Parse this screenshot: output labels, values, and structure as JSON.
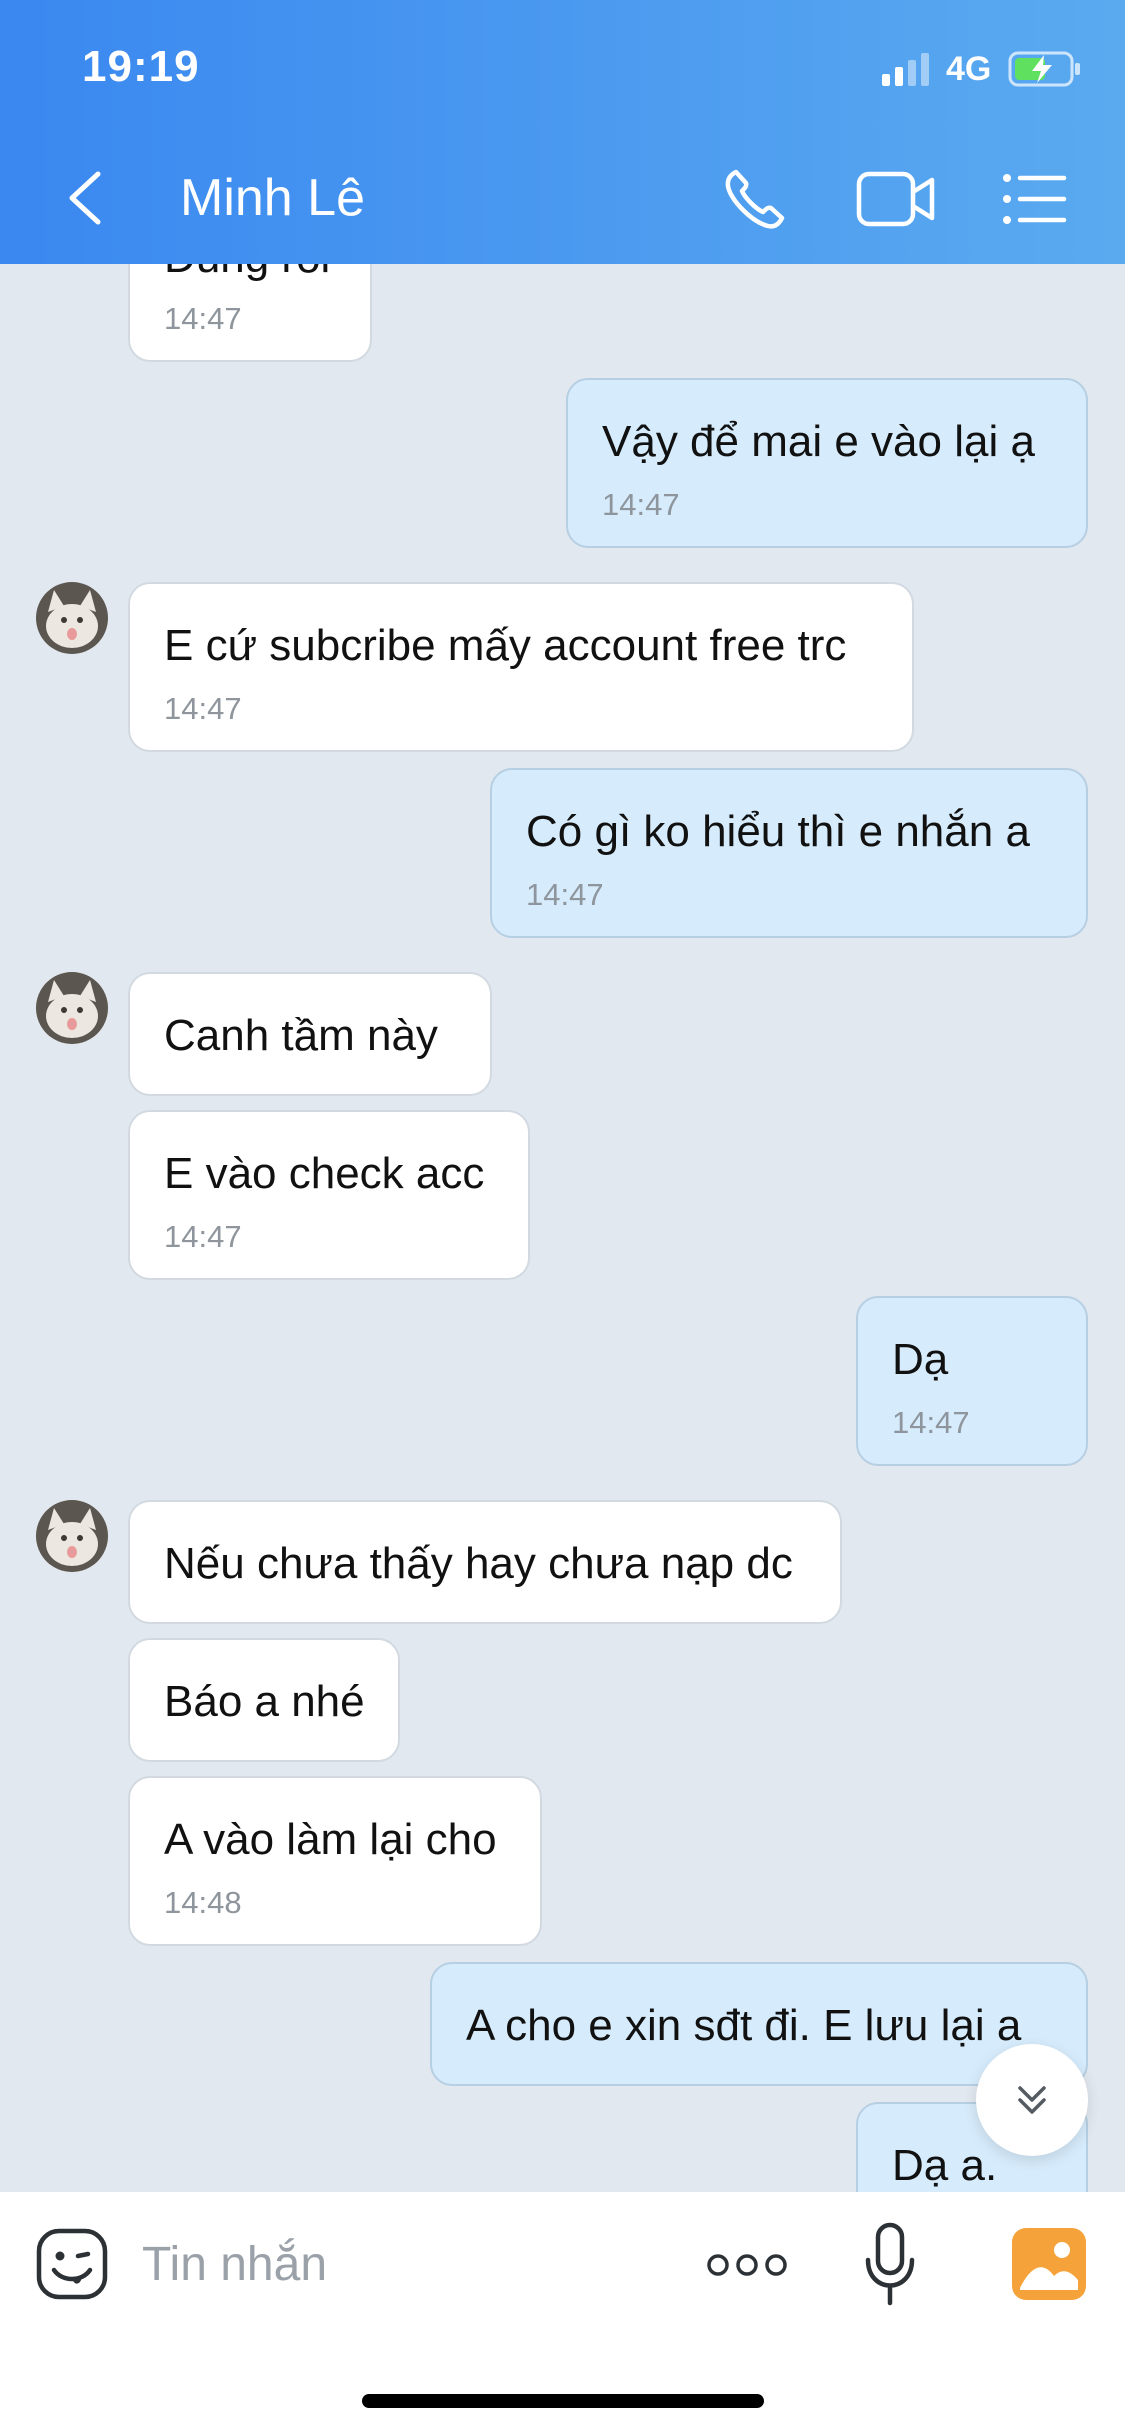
{
  "status_bar": {
    "time": "19:19",
    "network": "4G"
  },
  "header": {
    "contact_name": "Minh Lê",
    "back_icon": "chevron-left-icon",
    "call_icon": "phone-icon",
    "video_icon": "video-camera-icon",
    "menu_icon": "list-menu-icon"
  },
  "messages": [
    {
      "text": "Đúng rồi",
      "time": "14:47",
      "direction": "in"
    },
    {
      "text": "Vậy để mai e vào lại ạ",
      "time": "14:47",
      "direction": "out"
    },
    {
      "text": "E cứ subcribe mấy account free trc",
      "time": "14:47",
      "direction": "in"
    },
    {
      "text": "Có gì ko hiểu thì e nhắn a",
      "time": "14:47",
      "direction": "out"
    },
    {
      "text": "Canh tầm này",
      "time": "",
      "direction": "in"
    },
    {
      "text": "E vào check acc",
      "time": "14:47",
      "direction": "in"
    },
    {
      "text": "Dạ",
      "time": "14:47",
      "direction": "out"
    },
    {
      "text": "Nếu chưa thấy hay chưa nạp dc",
      "time": "",
      "direction": "in"
    },
    {
      "text": "Báo a nhé",
      "time": "",
      "direction": "in"
    },
    {
      "text": "A vào làm lại cho",
      "time": "14:48",
      "direction": "in"
    },
    {
      "text": "A cho e xin sđt đi. E lưu lại a",
      "time": "",
      "direction": "out"
    },
    {
      "text": "Dạ a.",
      "time": "",
      "direction": "out"
    }
  ],
  "composer": {
    "placeholder": "Tin nhắn",
    "sticker_icon": "sticker-face-icon",
    "more_icon": "more-dots-icon",
    "mic_icon": "microphone-icon",
    "photo_icon": "photo-gallery-icon"
  },
  "scroll_down_icon": "double-chevron-down-icon",
  "colors": {
    "header_gradient_start": "#3a88f0",
    "header_gradient_end": "#5aaaf0",
    "chat_background": "#e2e8ef",
    "incoming_bubble": "#ffffff",
    "outgoing_bubble": "#d6ebfb",
    "timestamp": "#8e959c",
    "photo_icon": "#f5a23a"
  }
}
